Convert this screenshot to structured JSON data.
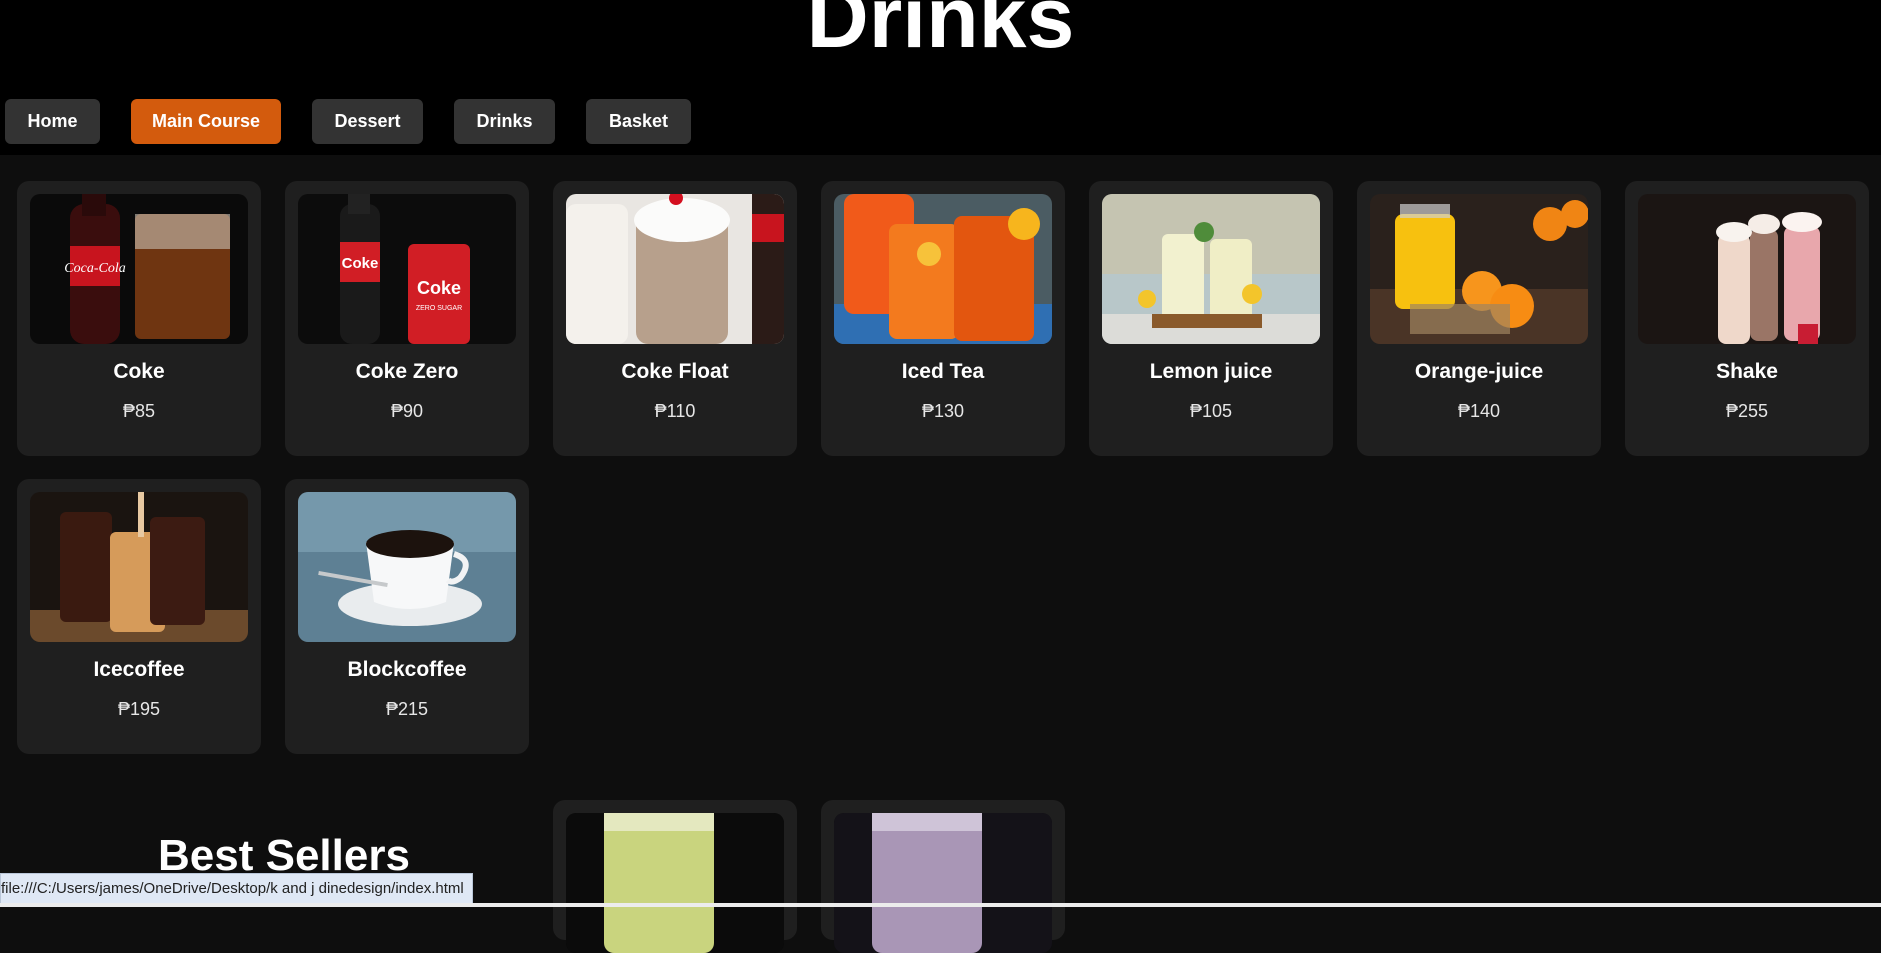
{
  "page": {
    "title": "Drinks"
  },
  "nav": {
    "items": [
      {
        "label": "Home",
        "active": false
      },
      {
        "label": "Main Course",
        "active": true
      },
      {
        "label": "Dessert",
        "active": false
      },
      {
        "label": "Drinks",
        "active": false
      },
      {
        "label": "Basket",
        "active": false
      }
    ]
  },
  "colors": {
    "page_bg": "#0e0e0e",
    "header_bg": "#000000",
    "card_bg": "#1f1f1f",
    "button_bg": "#333333",
    "accent": "#d35b0d"
  },
  "products": [
    {
      "name": "Coke",
      "price": "₱85",
      "image": "coca-cola-bottle-and-glass-photo"
    },
    {
      "name": "Coke Zero",
      "price": "₱90",
      "image": "coke-zero-bottle-and-can-photo"
    },
    {
      "name": "Coke Float",
      "price": "₱110",
      "image": "coke-float-photo"
    },
    {
      "name": "Iced Tea",
      "price": "₱130",
      "image": "iced-tea-photo"
    },
    {
      "name": "Lemon juice",
      "price": "₱105",
      "image": "lemon-juice-photo"
    },
    {
      "name": "Orange-juice",
      "price": "₱140",
      "image": "orange-juice-photo"
    },
    {
      "name": "Shake",
      "price": "₱255",
      "image": "milkshakes-photo"
    },
    {
      "name": "Icecoffee",
      "price": "₱195",
      "image": "iced-coffee-photo"
    },
    {
      "name": "Blockcoffee",
      "price": "₱215",
      "image": "black-coffee-cup-photo"
    }
  ],
  "best_sellers": {
    "title": "Best Sellers",
    "items": [
      {
        "image": "green-smoothie-photo"
      },
      {
        "image": "purple-smoothie-photo"
      }
    ]
  },
  "status_bar": {
    "url": "file:///C:/Users/james/OneDrive/Desktop/k and j dinedesign/index.html"
  }
}
